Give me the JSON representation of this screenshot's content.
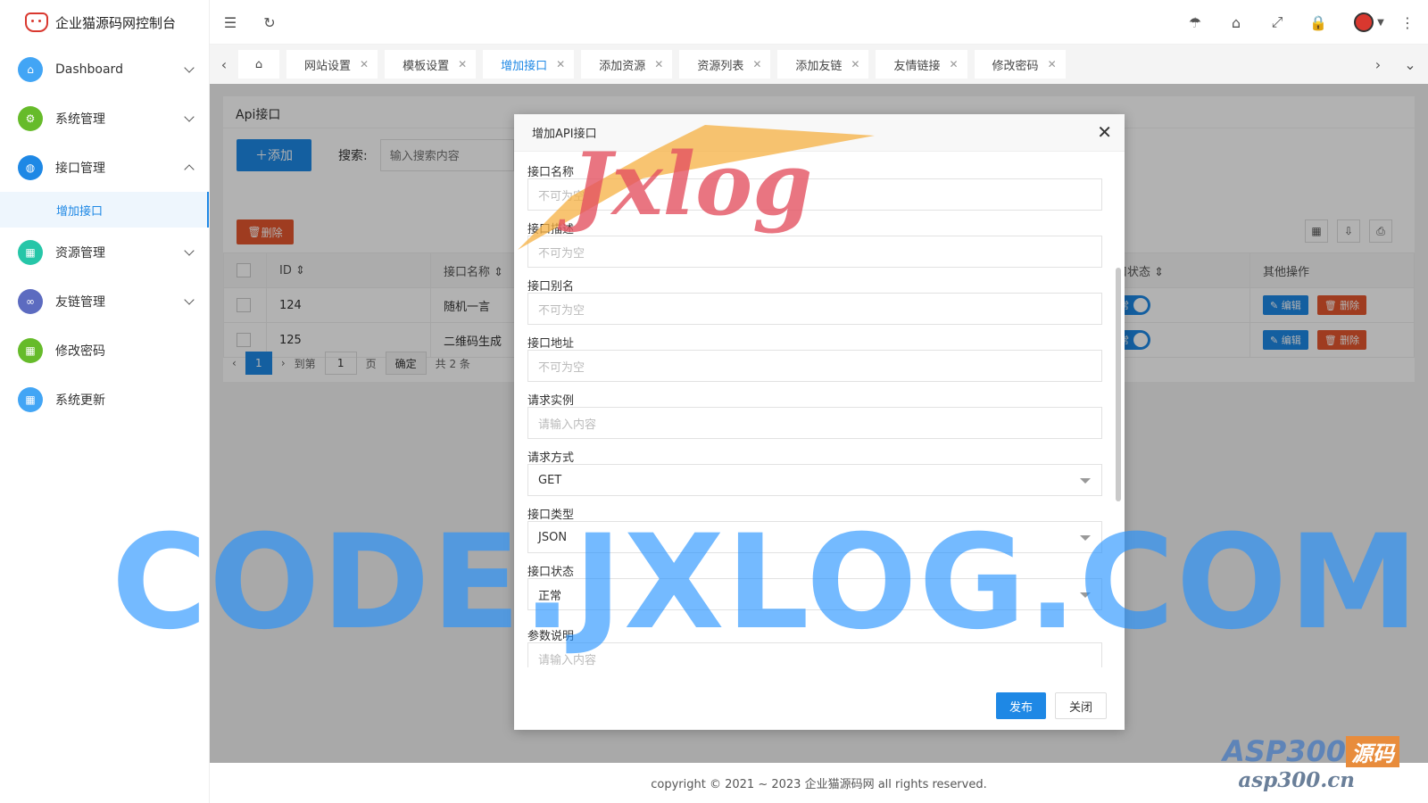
{
  "app": {
    "title": "企业猫源码网控制台"
  },
  "sidebar": {
    "items": [
      {
        "label": "Dashboard",
        "color": "#42a5f5",
        "icon": "home-icon",
        "expanded": false
      },
      {
        "label": "系统管理",
        "color": "#66bb2a",
        "icon": "gear-icon",
        "expanded": false
      },
      {
        "label": "接口管理",
        "color": "#1e88e5",
        "icon": "globe-icon",
        "expanded": true
      },
      {
        "label": "资源管理",
        "color": "#26c6a8",
        "icon": "grid-icon",
        "expanded": false
      },
      {
        "label": "友链管理",
        "color": "#5c6bc0",
        "icon": "link-icon",
        "expanded": false
      },
      {
        "label": "修改密码",
        "color": "#66bb2a",
        "icon": "grid-icon",
        "expanded": false
      },
      {
        "label": "系统更新",
        "color": "#42a5f5",
        "icon": "grid-icon",
        "expanded": false
      }
    ],
    "sub_active": "增加接口"
  },
  "tabs": [
    {
      "label": "网站设置"
    },
    {
      "label": "模板设置"
    },
    {
      "label": "增加接口",
      "active": true
    },
    {
      "label": "添加资源"
    },
    {
      "label": "资源列表"
    },
    {
      "label": "添加友链"
    },
    {
      "label": "友情链接"
    },
    {
      "label": "修改密码"
    }
  ],
  "panel": {
    "title": "Api接口",
    "add_label": "添加",
    "search_label": "搜索:",
    "search_placeholder": "输入搜索内容",
    "delete_label": "删除",
    "columns": [
      "ID",
      "接口名称",
      "接口状态",
      "其他操作"
    ],
    "rows": [
      {
        "id": "124",
        "name": "随机一言",
        "status": "正常"
      },
      {
        "id": "125",
        "name": "二维码生成",
        "status": "正常"
      }
    ],
    "edit_label": "编辑",
    "row_delete_label": "删除",
    "pager": {
      "current": "1",
      "goto": "到第",
      "page_value": "1",
      "page_unit": "页",
      "confirm": "确定",
      "total": "共 2 条"
    }
  },
  "modal": {
    "title": "增加API接口",
    "fields": [
      {
        "label": "接口名称",
        "placeholder": "不可为空"
      },
      {
        "label": "接口描述",
        "placeholder": "不可为空"
      },
      {
        "label": "接口别名",
        "placeholder": "不可为空"
      },
      {
        "label": "接口地址",
        "placeholder": "不可为空"
      },
      {
        "label": "请求实例",
        "placeholder": "请输入内容"
      }
    ],
    "selects": [
      {
        "label": "请求方式",
        "value": "GET"
      },
      {
        "label": "接口类型",
        "value": "JSON"
      },
      {
        "label": "接口状态",
        "value": "正常"
      }
    ],
    "textarea": {
      "label": "参数说明",
      "placeholder": "请输入内容"
    },
    "publish_label": "发布",
    "close_label": "关闭"
  },
  "footer": {
    "text": "copyright © 2021 ~ 2023 企业猫源码网 all rights reserved."
  },
  "watermarks": {
    "big": "CODE.JXLOG.COM",
    "jxlog": "Jxlog",
    "asp_top": "ASP300",
    "asp_badge": "源码",
    "asp_bottom": "asp300.cn"
  }
}
